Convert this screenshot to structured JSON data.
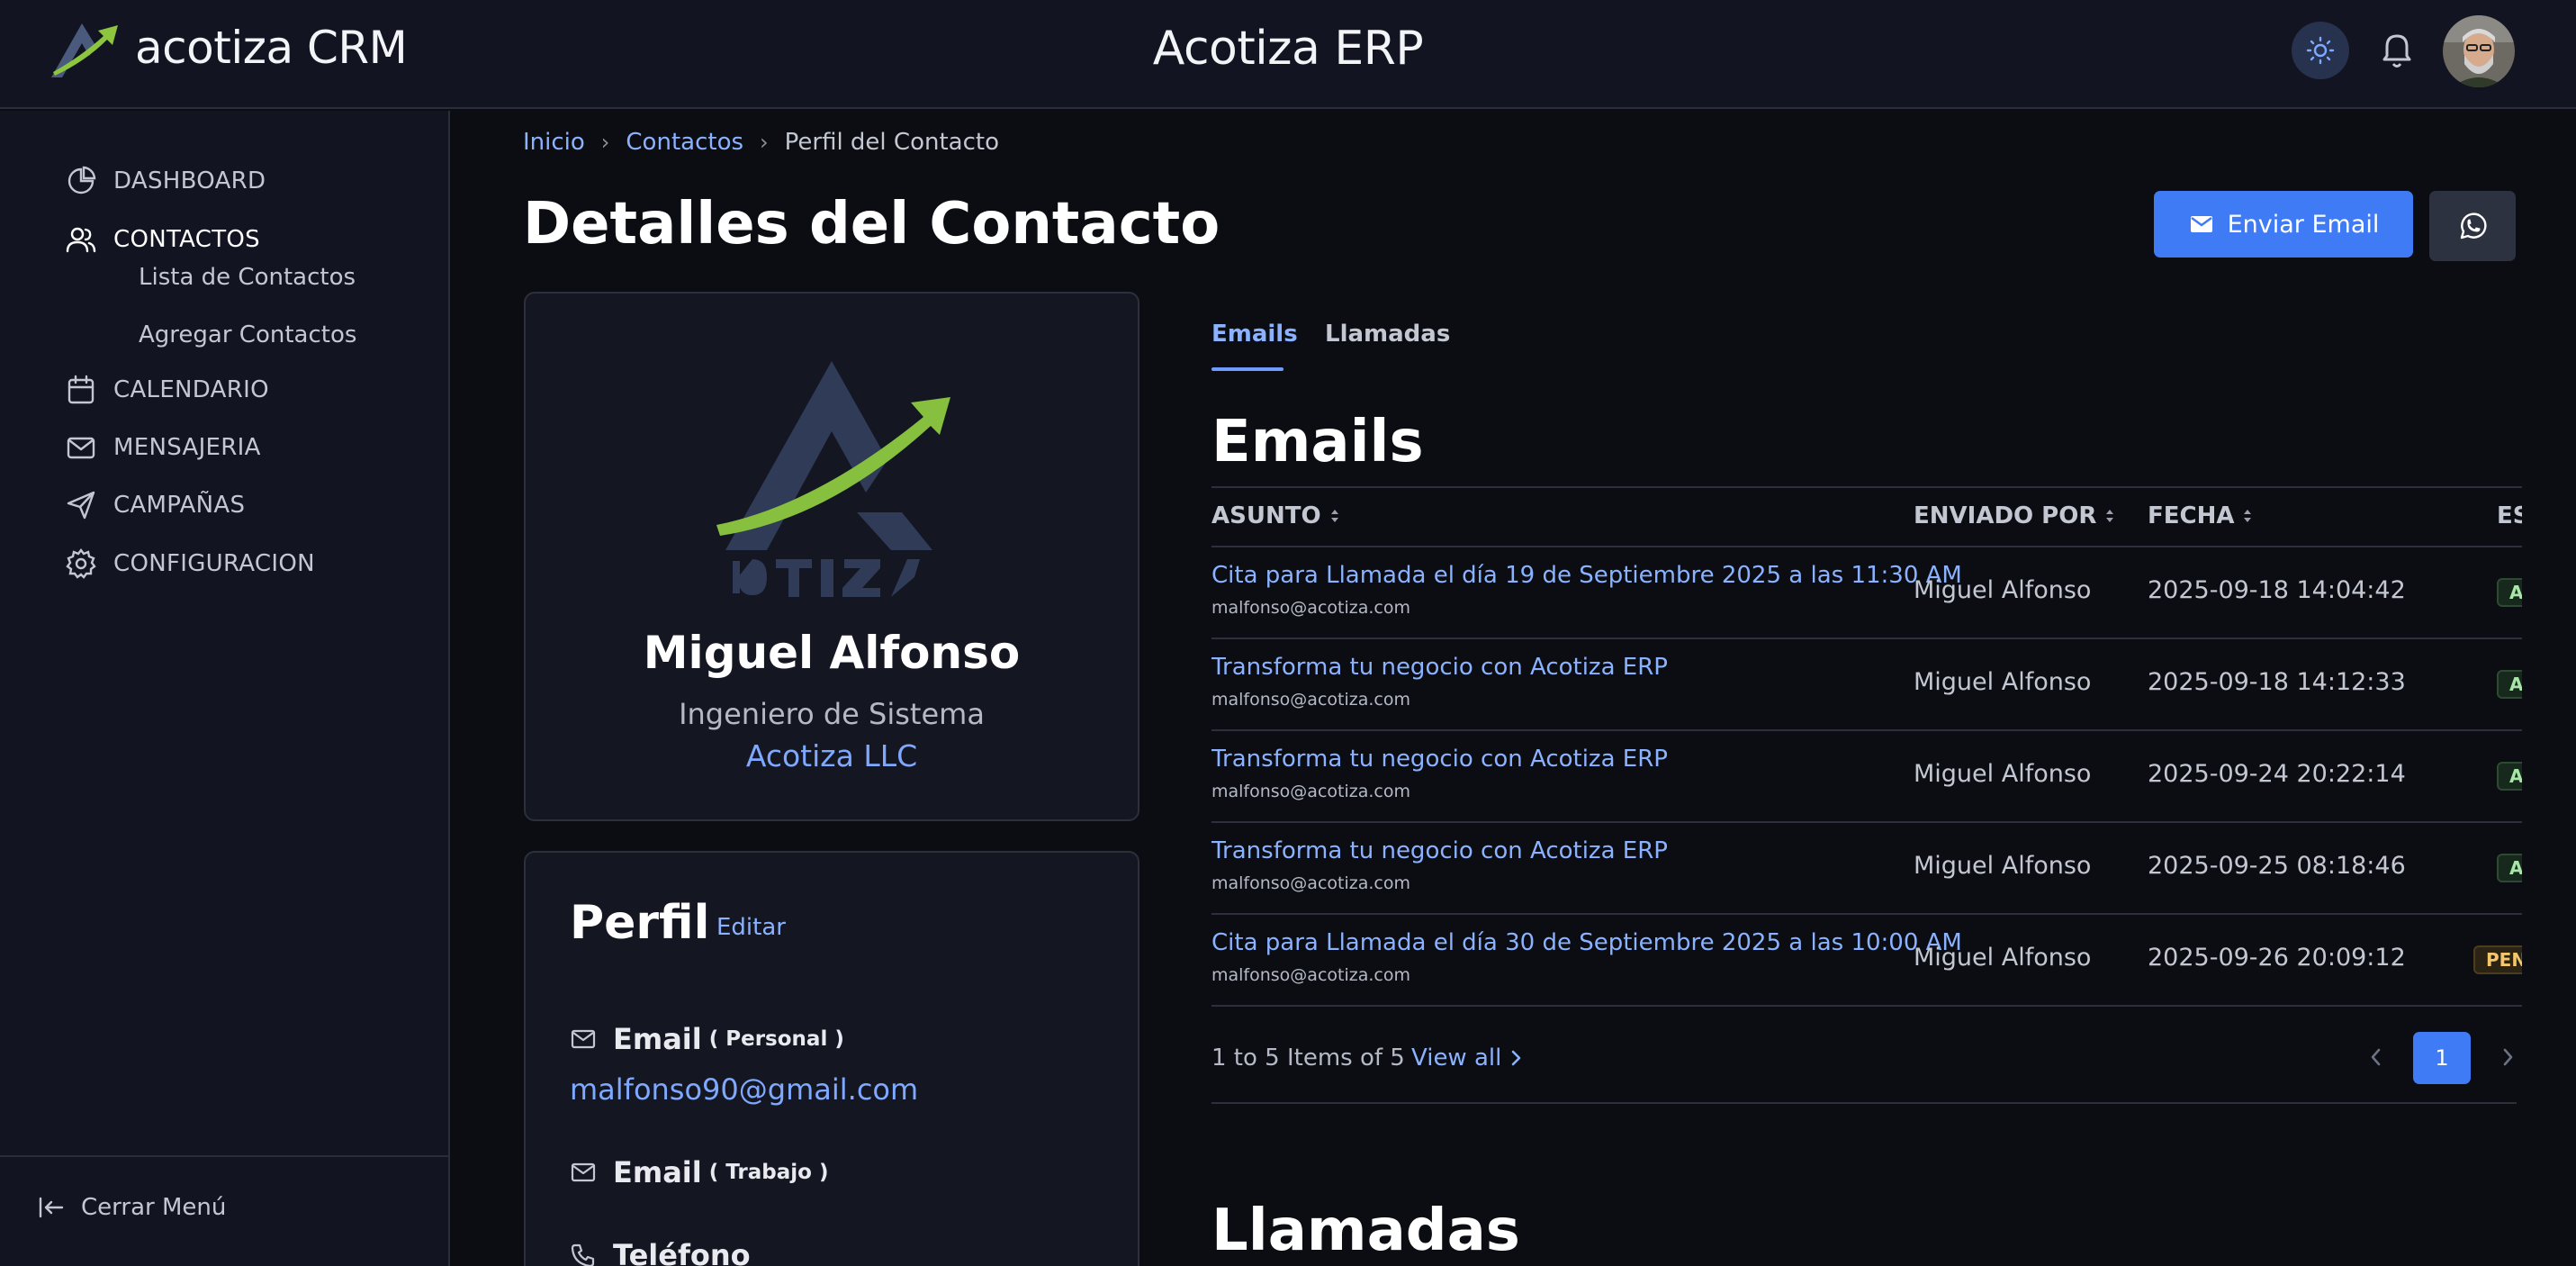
{
  "header": {
    "brand": "acotiza CRM",
    "app_title": "Acotiza ERP"
  },
  "sidebar": {
    "items": [
      {
        "label": "DASHBOARD",
        "icon": "pie-chart-icon"
      },
      {
        "label": "CONTACTOS",
        "icon": "users-icon"
      },
      {
        "label": "Lista de Contactos"
      },
      {
        "label": "Agregar Contactos"
      },
      {
        "label": "CALENDARIO",
        "icon": "calendar-icon"
      },
      {
        "label": "MENSAJERIA",
        "icon": "mail-icon"
      },
      {
        "label": "CAMPAÑAS",
        "icon": "send-icon"
      },
      {
        "label": "CONFIGURACION",
        "icon": "gear-icon"
      }
    ],
    "close_menu": "Cerrar Menú"
  },
  "breadcrumb": {
    "home": "Inicio",
    "contacts": "Contactos",
    "current": "Perfil del Contacto"
  },
  "page": {
    "title": "Detalles del Contacto",
    "send_email": "Enviar Email"
  },
  "contact": {
    "name": "Miguel Alfonso",
    "role": "Ingeniero de Sistema",
    "company": "Acotiza LLC"
  },
  "profile": {
    "title": "Perfil",
    "edit": "Editar",
    "email_label": "Email",
    "personal_tag": "( Personal )",
    "personal_email": "malfonso90@gmail.com",
    "work_tag": "( Trabajo )",
    "phone_label": "Teléfono"
  },
  "tabs": [
    "Emails",
    "Llamadas"
  ],
  "emails": {
    "title": "Emails",
    "columns": [
      "ASUNTO",
      "ENVIADO POR",
      "FECHA",
      "ES"
    ],
    "rows": [
      {
        "subject": "Cita para Llamada el día 19 de Septiembre 2025 a las 11:30 AM",
        "email": "malfonso@acotiza.com",
        "sender": "Miguel Alfonso",
        "date": "2025-09-18 14:04:42",
        "status": "A"
      },
      {
        "subject": "Transforma tu negocio con Acotiza ERP",
        "email": "malfonso@acotiza.com",
        "sender": "Miguel Alfonso",
        "date": "2025-09-18 14:12:33",
        "status": "A"
      },
      {
        "subject": "Transforma tu negocio con Acotiza ERP",
        "email": "malfonso@acotiza.com",
        "sender": "Miguel Alfonso",
        "date": "2025-09-24 20:22:14",
        "status": "A"
      },
      {
        "subject": "Transforma tu negocio con Acotiza ERP",
        "email": "malfonso@acotiza.com",
        "sender": "Miguel Alfonso",
        "date": "2025-09-25 08:18:46",
        "status": "A"
      },
      {
        "subject": "Cita para Llamada el día 30 de Septiembre 2025 a las 10:00 AM",
        "email": "malfonso@acotiza.com",
        "sender": "Miguel Alfonso",
        "date": "2025-09-26 20:09:12",
        "status": "PEN"
      }
    ],
    "pager_text": "1 to 5 Items of 5",
    "view_all": "View all",
    "page": "1"
  },
  "calls": {
    "title": "Llamadas"
  },
  "colors": {
    "accent": "#3f7bf5",
    "link": "#8ab2ff",
    "background": "#0b0d13",
    "panel": "#121521"
  }
}
